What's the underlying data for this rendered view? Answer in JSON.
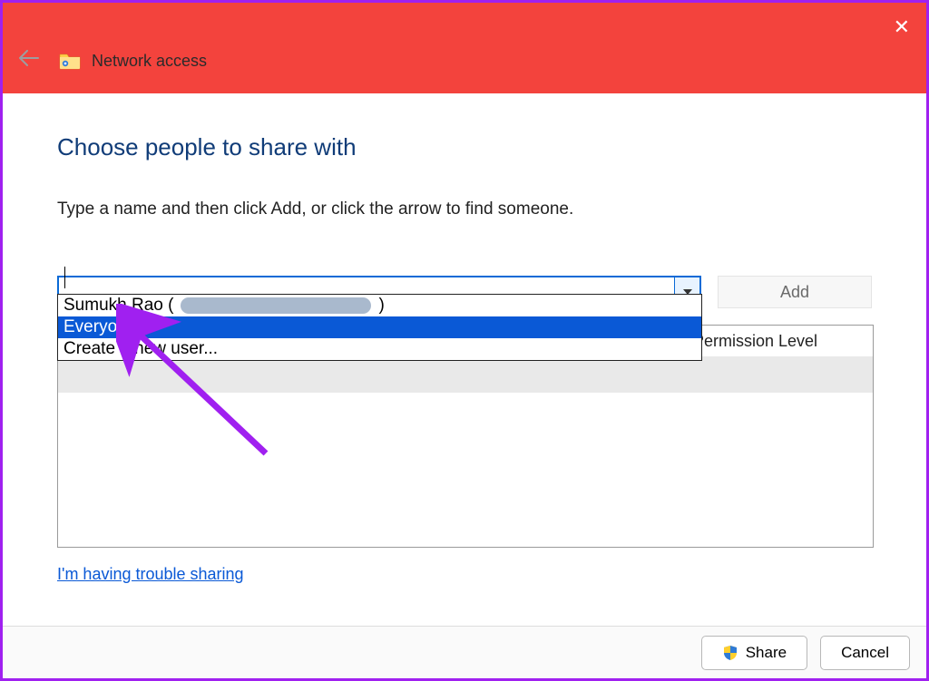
{
  "window": {
    "title": "Network access"
  },
  "page": {
    "heading": "Choose people to share with",
    "instruction": "Type a name and then click Add, or click the arrow to find someone.",
    "add_button": "Add",
    "trouble_link": "I'm having trouble sharing"
  },
  "combo": {
    "value": "",
    "placeholder": ""
  },
  "dropdown": {
    "items": [
      {
        "label": "Sumukh Rao (",
        "trailing": ")",
        "redacted": true,
        "selected": false
      },
      {
        "label": "Everyone",
        "selected": true
      },
      {
        "label": "Create a new user...",
        "selected": false
      }
    ]
  },
  "columns": {
    "permission": "Permission Level"
  },
  "footer": {
    "share": "Share",
    "cancel": "Cancel"
  }
}
